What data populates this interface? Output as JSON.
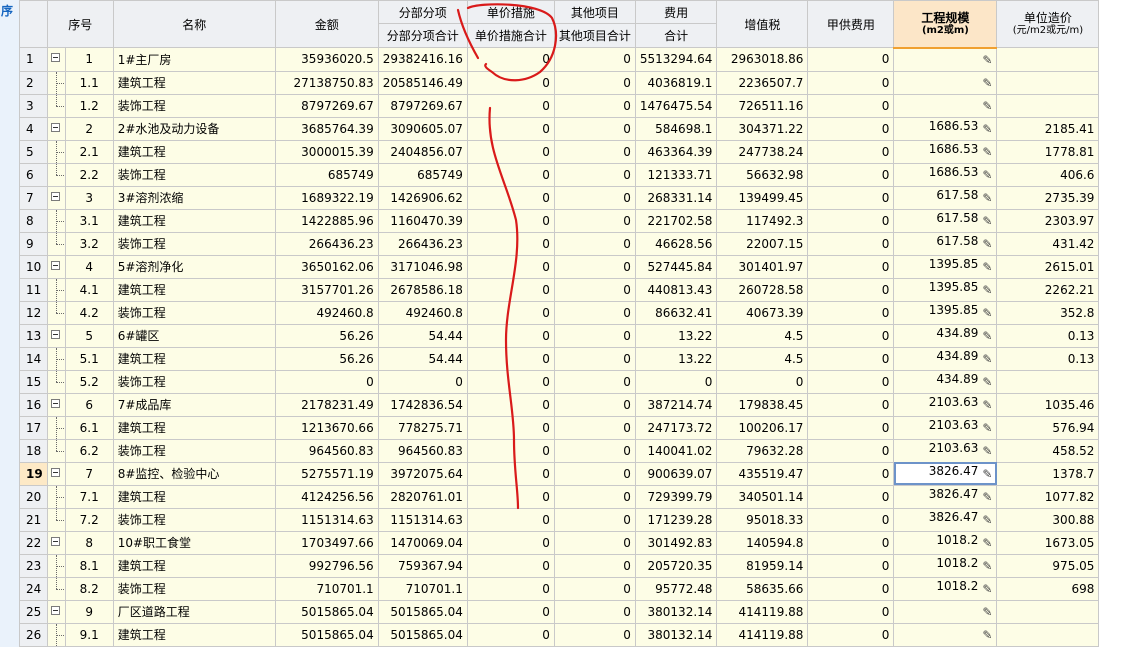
{
  "side_label": "序",
  "header": {
    "seq": "序号",
    "name": "名称",
    "amount": "金额",
    "fenbu_top": "分部分项",
    "fenbu_sub": "分部分项合计",
    "danjia_top": "单价措施",
    "danjia_sub": "单价措施合计",
    "qita_top": "其他项目",
    "qita_sub": "其他项目合计",
    "fei_top": "费用",
    "fei_sub": "合计",
    "vat": "增值税",
    "jiagong": "甲供费用",
    "scale_line1": "工程规模",
    "scale_line2": "(m2或m)",
    "unit_line1": "单位造价",
    "unit_line2": "(元/m2或元/m)"
  },
  "icons": {
    "expand": "collapse-minus-icon",
    "edit": "pencil-edit-icon"
  },
  "colors": {
    "row_bg": "#fdfde6",
    "header_bg": "#eef0f3",
    "selected_header": "#fce6c8",
    "annotation": "#d91a1a"
  },
  "selected_row": "19",
  "rows": [
    {
      "rn": "1",
      "level": 0,
      "seq": "1",
      "name": "1#主厂房",
      "amount": "35936020.5",
      "fenbu": "29382416.16",
      "danjia": "0",
      "qita": "0",
      "fei": "5513294.64",
      "vat": "2963018.86",
      "jiagong": "0",
      "scale": "",
      "unit": ""
    },
    {
      "rn": "2",
      "level": 1,
      "seq": "1.1",
      "name": "建筑工程",
      "amount": "27138750.83",
      "fenbu": "20585146.49",
      "danjia": "0",
      "qita": "0",
      "fei": "4036819.1",
      "vat": "2236507.7",
      "jiagong": "0",
      "scale": "",
      "unit": ""
    },
    {
      "rn": "3",
      "level": 1,
      "last": true,
      "seq": "1.2",
      "name": "装饰工程",
      "amount": "8797269.67",
      "fenbu": "8797269.67",
      "danjia": "0",
      "qita": "0",
      "fei": "1476475.54",
      "vat": "726511.16",
      "jiagong": "0",
      "scale": "",
      "unit": ""
    },
    {
      "rn": "4",
      "level": 0,
      "seq": "2",
      "name": "2#水池及动力设备",
      "amount": "3685764.39",
      "fenbu": "3090605.07",
      "danjia": "0",
      "qita": "0",
      "fei": "584698.1",
      "vat": "304371.22",
      "jiagong": "0",
      "scale": "1686.53",
      "unit": "2185.41"
    },
    {
      "rn": "5",
      "level": 1,
      "seq": "2.1",
      "name": "建筑工程",
      "amount": "3000015.39",
      "fenbu": "2404856.07",
      "danjia": "0",
      "qita": "0",
      "fei": "463364.39",
      "vat": "247738.24",
      "jiagong": "0",
      "scale": "1686.53",
      "unit": "1778.81"
    },
    {
      "rn": "6",
      "level": 1,
      "last": true,
      "seq": "2.2",
      "name": "装饰工程",
      "amount": "685749",
      "fenbu": "685749",
      "danjia": "0",
      "qita": "0",
      "fei": "121333.71",
      "vat": "56632.98",
      "jiagong": "0",
      "scale": "1686.53",
      "unit": "406.6"
    },
    {
      "rn": "7",
      "level": 0,
      "seq": "3",
      "name": "3#溶剂浓缩",
      "amount": "1689322.19",
      "fenbu": "1426906.62",
      "danjia": "0",
      "qita": "0",
      "fei": "268331.14",
      "vat": "139499.45",
      "jiagong": "0",
      "scale": "617.58",
      "unit": "2735.39"
    },
    {
      "rn": "8",
      "level": 1,
      "seq": "3.1",
      "name": "建筑工程",
      "amount": "1422885.96",
      "fenbu": "1160470.39",
      "danjia": "0",
      "qita": "0",
      "fei": "221702.58",
      "vat": "117492.3",
      "jiagong": "0",
      "scale": "617.58",
      "unit": "2303.97"
    },
    {
      "rn": "9",
      "level": 1,
      "last": true,
      "seq": "3.2",
      "name": "装饰工程",
      "amount": "266436.23",
      "fenbu": "266436.23",
      "danjia": "0",
      "qita": "0",
      "fei": "46628.56",
      "vat": "22007.15",
      "jiagong": "0",
      "scale": "617.58",
      "unit": "431.42"
    },
    {
      "rn": "10",
      "level": 0,
      "seq": "4",
      "name": "5#溶剂净化",
      "amount": "3650162.06",
      "fenbu": "3171046.98",
      "danjia": "0",
      "qita": "0",
      "fei": "527445.84",
      "vat": "301401.97",
      "jiagong": "0",
      "scale": "1395.85",
      "unit": "2615.01"
    },
    {
      "rn": "11",
      "level": 1,
      "seq": "4.1",
      "name": "建筑工程",
      "amount": "3157701.26",
      "fenbu": "2678586.18",
      "danjia": "0",
      "qita": "0",
      "fei": "440813.43",
      "vat": "260728.58",
      "jiagong": "0",
      "scale": "1395.85",
      "unit": "2262.21"
    },
    {
      "rn": "12",
      "level": 1,
      "last": true,
      "seq": "4.2",
      "name": "装饰工程",
      "amount": "492460.8",
      "fenbu": "492460.8",
      "danjia": "0",
      "qita": "0",
      "fei": "86632.41",
      "vat": "40673.39",
      "jiagong": "0",
      "scale": "1395.85",
      "unit": "352.8"
    },
    {
      "rn": "13",
      "level": 0,
      "seq": "5",
      "name": "6#罐区",
      "amount": "56.26",
      "fenbu": "54.44",
      "danjia": "0",
      "qita": "0",
      "fei": "13.22",
      "vat": "4.5",
      "jiagong": "0",
      "scale": "434.89",
      "unit": "0.13"
    },
    {
      "rn": "14",
      "level": 1,
      "seq": "5.1",
      "name": "建筑工程",
      "amount": "56.26",
      "fenbu": "54.44",
      "danjia": "0",
      "qita": "0",
      "fei": "13.22",
      "vat": "4.5",
      "jiagong": "0",
      "scale": "434.89",
      "unit": "0.13"
    },
    {
      "rn": "15",
      "level": 1,
      "last": true,
      "seq": "5.2",
      "name": "装饰工程",
      "amount": "0",
      "fenbu": "0",
      "danjia": "0",
      "qita": "0",
      "fei": "0",
      "vat": "0",
      "jiagong": "0",
      "scale": "434.89",
      "unit": ""
    },
    {
      "rn": "16",
      "level": 0,
      "seq": "6",
      "name": "7#成品库",
      "amount": "2178231.49",
      "fenbu": "1742836.54",
      "danjia": "0",
      "qita": "0",
      "fei": "387214.74",
      "vat": "179838.45",
      "jiagong": "0",
      "scale": "2103.63",
      "unit": "1035.46"
    },
    {
      "rn": "17",
      "level": 1,
      "seq": "6.1",
      "name": "建筑工程",
      "amount": "1213670.66",
      "fenbu": "778275.71",
      "danjia": "0",
      "qita": "0",
      "fei": "247173.72",
      "vat": "100206.17",
      "jiagong": "0",
      "scale": "2103.63",
      "unit": "576.94"
    },
    {
      "rn": "18",
      "level": 1,
      "last": true,
      "seq": "6.2",
      "name": "装饰工程",
      "amount": "964560.83",
      "fenbu": "964560.83",
      "danjia": "0",
      "qita": "0",
      "fei": "140041.02",
      "vat": "79632.28",
      "jiagong": "0",
      "scale": "2103.63",
      "unit": "458.52"
    },
    {
      "rn": "19",
      "level": 0,
      "seq": "7",
      "name": "8#监控、检验中心",
      "amount": "5275571.19",
      "fenbu": "3972075.64",
      "danjia": "0",
      "qita": "0",
      "fei": "900639.07",
      "vat": "435519.47",
      "jiagong": "0",
      "scale": "3826.47",
      "unit": "1378.7"
    },
    {
      "rn": "20",
      "level": 1,
      "seq": "7.1",
      "name": "建筑工程",
      "amount": "4124256.56",
      "fenbu": "2820761.01",
      "danjia": "0",
      "qita": "0",
      "fei": "729399.79",
      "vat": "340501.14",
      "jiagong": "0",
      "scale": "3826.47",
      "unit": "1077.82"
    },
    {
      "rn": "21",
      "level": 1,
      "last": true,
      "seq": "7.2",
      "name": "装饰工程",
      "amount": "1151314.63",
      "fenbu": "1151314.63",
      "danjia": "0",
      "qita": "0",
      "fei": "171239.28",
      "vat": "95018.33",
      "jiagong": "0",
      "scale": "3826.47",
      "unit": "300.88"
    },
    {
      "rn": "22",
      "level": 0,
      "seq": "8",
      "name": "10#职工食堂",
      "amount": "1703497.66",
      "fenbu": "1470069.04",
      "danjia": "0",
      "qita": "0",
      "fei": "301492.83",
      "vat": "140594.8",
      "jiagong": "0",
      "scale": "1018.2",
      "unit": "1673.05"
    },
    {
      "rn": "23",
      "level": 1,
      "seq": "8.1",
      "name": "建筑工程",
      "amount": "992796.56",
      "fenbu": "759367.94",
      "danjia": "0",
      "qita": "0",
      "fei": "205720.35",
      "vat": "81959.14",
      "jiagong": "0",
      "scale": "1018.2",
      "unit": "975.05"
    },
    {
      "rn": "24",
      "level": 1,
      "last": true,
      "seq": "8.2",
      "name": "装饰工程",
      "amount": "710701.1",
      "fenbu": "710701.1",
      "danjia": "0",
      "qita": "0",
      "fei": "95772.48",
      "vat": "58635.66",
      "jiagong": "0",
      "scale": "1018.2",
      "unit": "698"
    },
    {
      "rn": "25",
      "level": 0,
      "seq": "9",
      "name": "厂区道路工程",
      "amount": "5015865.04",
      "fenbu": "5015865.04",
      "danjia": "0",
      "qita": "0",
      "fei": "380132.14",
      "vat": "414119.88",
      "jiagong": "0",
      "scale": "",
      "unit": ""
    },
    {
      "rn": "26",
      "level": 1,
      "seq": "9.1",
      "name": "建筑工程",
      "amount": "5015865.04",
      "fenbu": "5015865.04",
      "danjia": "0",
      "qita": "0",
      "fei": "380132.14",
      "vat": "414119.88",
      "jiagong": "0",
      "scale": "",
      "unit": ""
    }
  ]
}
